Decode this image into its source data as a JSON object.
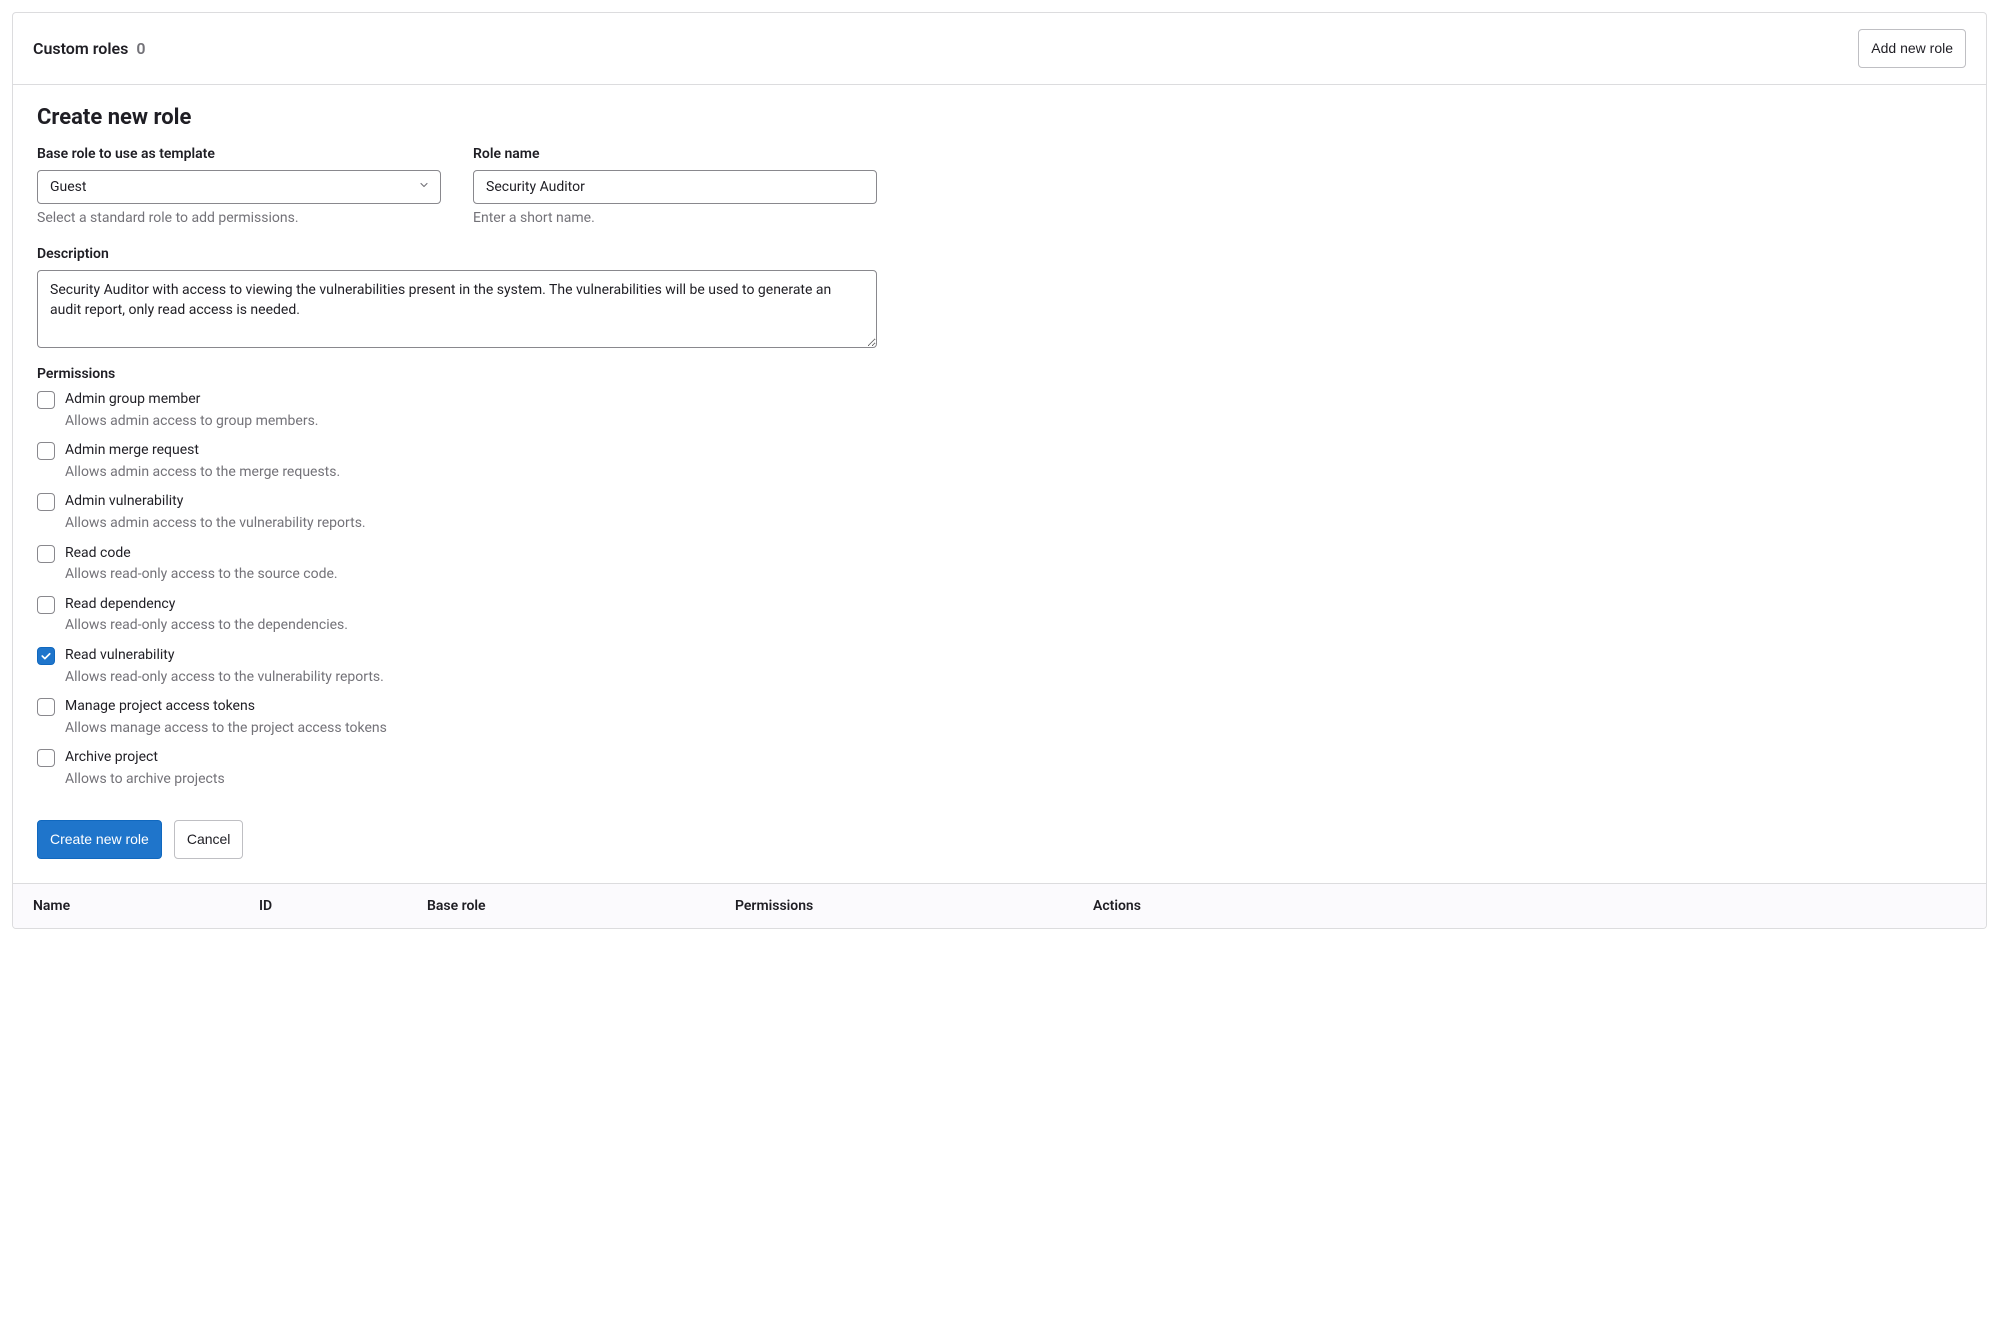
{
  "header": {
    "title": "Custom roles",
    "count": "0",
    "add_button": "Add new role"
  },
  "form": {
    "heading": "Create new role",
    "base_role": {
      "label": "Base role to use as template",
      "value": "Guest",
      "help": "Select a standard role to add permissions."
    },
    "role_name": {
      "label": "Role name",
      "value": "Security Auditor",
      "help": "Enter a short name."
    },
    "description": {
      "label": "Description",
      "value": "Security Auditor with access to viewing the vulnerabilities present in the system. The vulnerabilities will be used to generate an audit report, only read access is needed."
    },
    "permissions_label": "Permissions",
    "permissions": [
      {
        "label": "Admin group member",
        "desc": "Allows admin access to group members.",
        "checked": false
      },
      {
        "label": "Admin merge request",
        "desc": "Allows admin access to the merge requests.",
        "checked": false
      },
      {
        "label": "Admin vulnerability",
        "desc": "Allows admin access to the vulnerability reports.",
        "checked": false
      },
      {
        "label": "Read code",
        "desc": "Allows read-only access to the source code.",
        "checked": false
      },
      {
        "label": "Read dependency",
        "desc": "Allows read-only access to the dependencies.",
        "checked": false
      },
      {
        "label": "Read vulnerability",
        "desc": "Allows read-only access to the vulnerability reports.",
        "checked": true
      },
      {
        "label": "Manage project access tokens",
        "desc": "Allows manage access to the project access tokens",
        "checked": false
      },
      {
        "label": "Archive project",
        "desc": "Allows to archive projects",
        "checked": false
      }
    ],
    "submit_button": "Create new role",
    "cancel_button": "Cancel"
  },
  "table": {
    "columns": {
      "name": "Name",
      "id": "ID",
      "base_role": "Base role",
      "permissions": "Permissions",
      "actions": "Actions"
    }
  }
}
